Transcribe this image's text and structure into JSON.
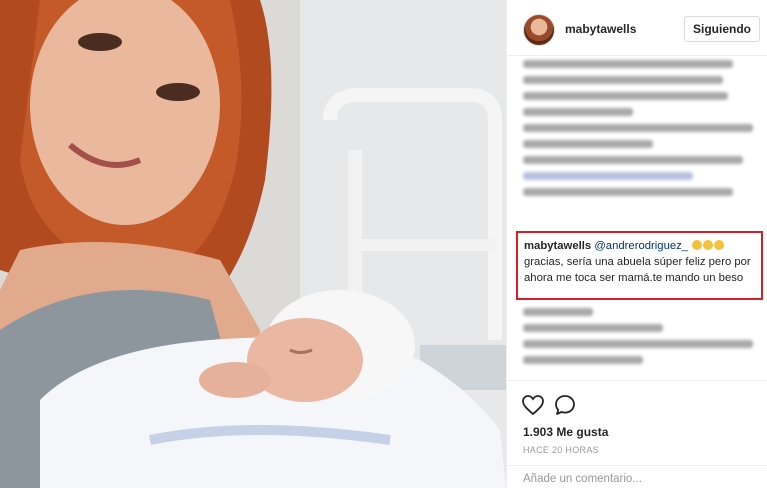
{
  "post": {
    "username": "mabytawells",
    "follow_label": "Siguiendo"
  },
  "highlighted_comment": {
    "username": "mabytawells",
    "mention": "@andrerodriguez_",
    "text": "gracias, sería una abuela súper feliz pero por ahora me toca ser mamá.te mando un beso"
  },
  "actions": {
    "likes": "1.903 Me gusta",
    "timestamp": "HACE 20 HORAS",
    "comment_placeholder": "Añade un comentario..."
  },
  "icons": {
    "like": "heart-icon",
    "comment": "comment-bubble-icon"
  },
  "colors": {
    "highlight_border": "#d61f2a",
    "mention": "#003569"
  }
}
